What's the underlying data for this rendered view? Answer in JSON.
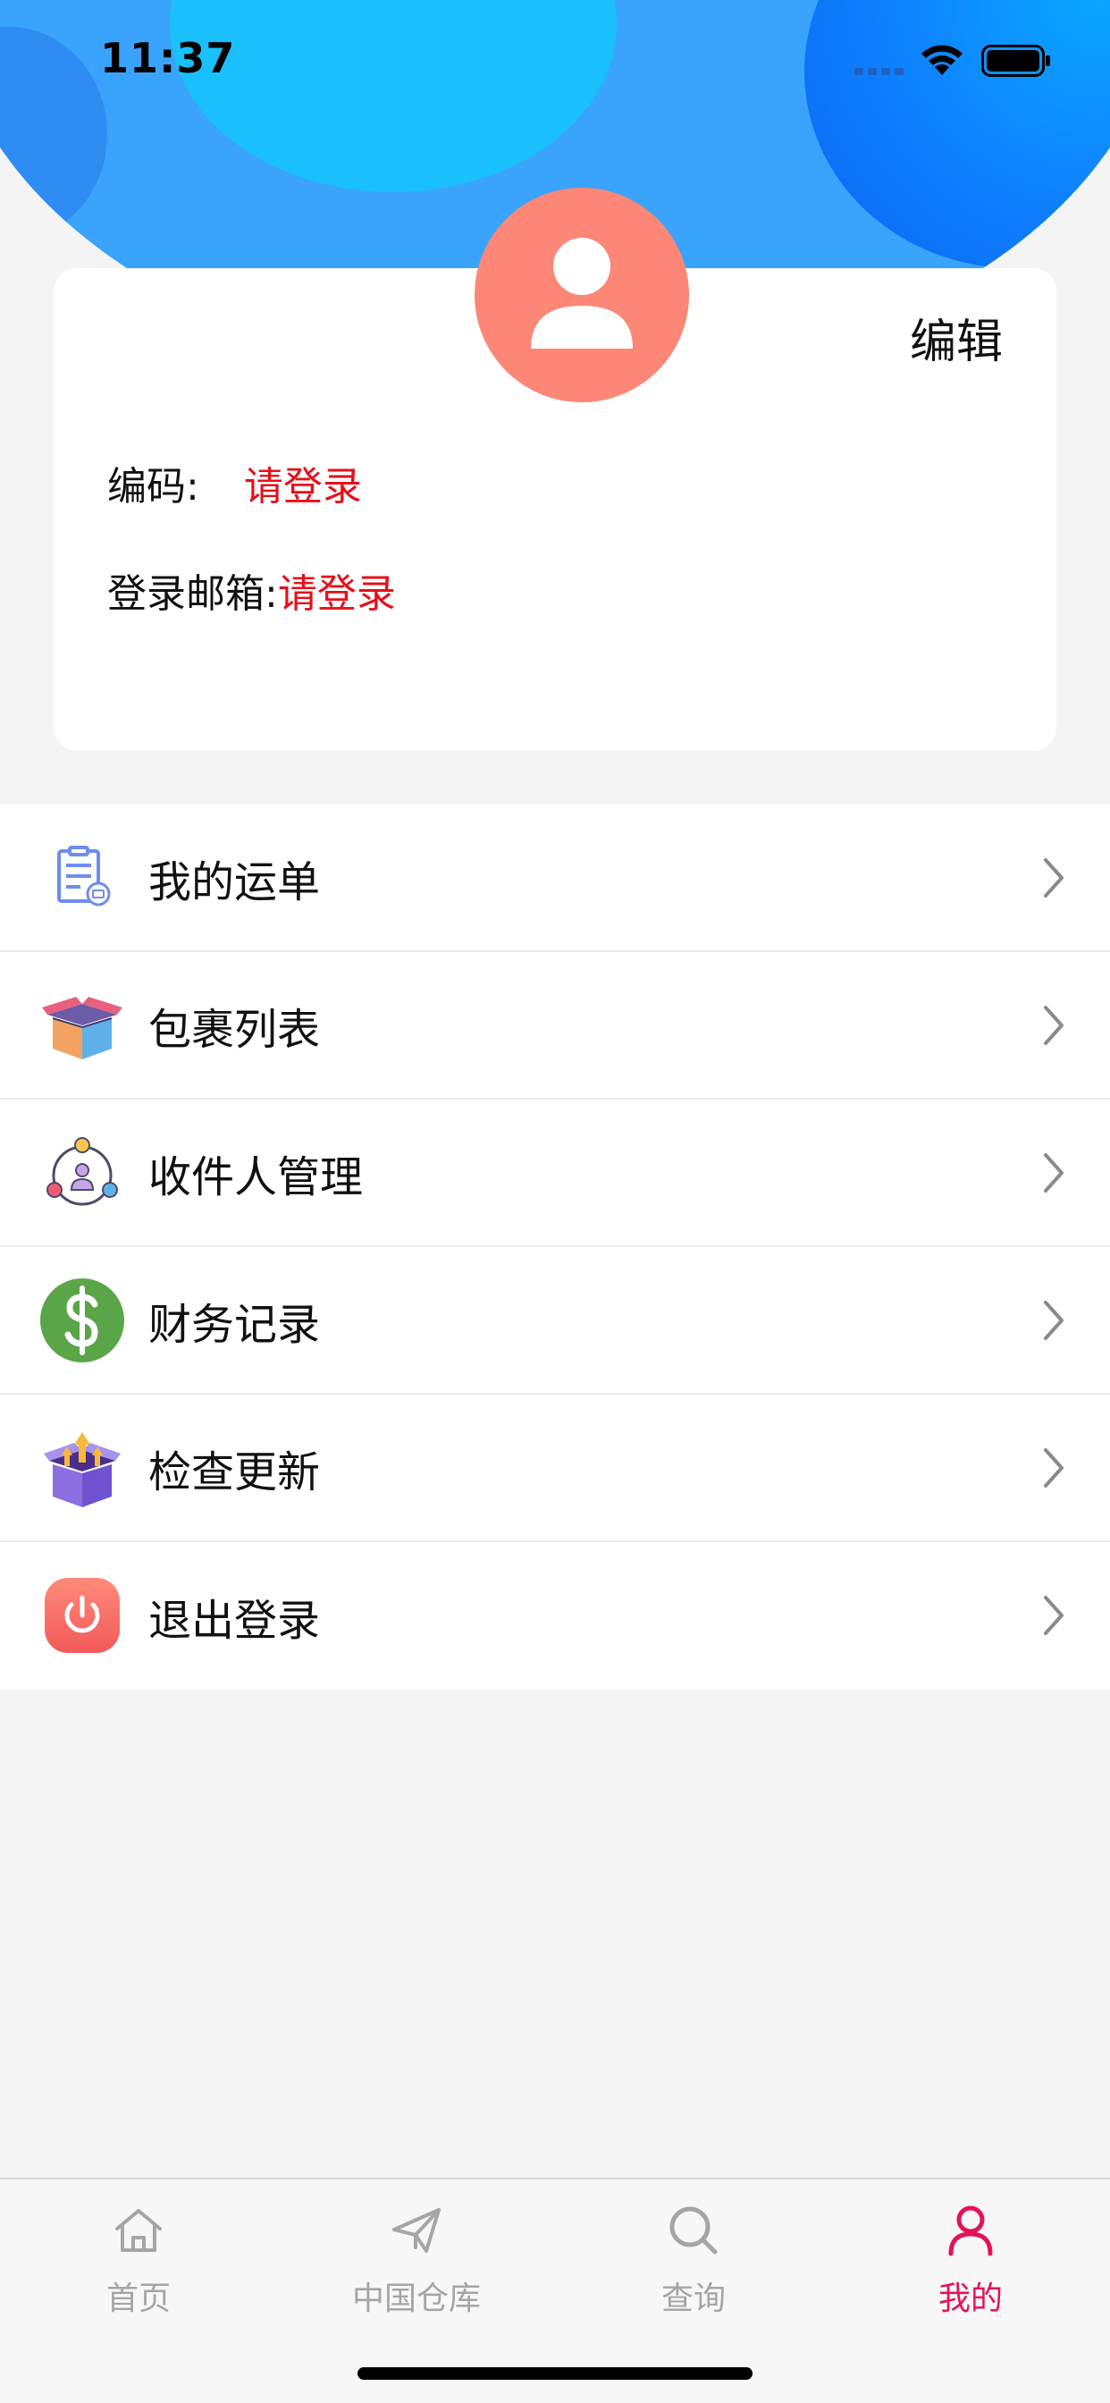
{
  "status_bar": {
    "time": "11:37"
  },
  "profile": {
    "edit_label": "编辑",
    "code_label": "编码:",
    "code_value": "请登录",
    "email_label": "登录邮箱:",
    "email_value": "请登录"
  },
  "menu": {
    "items": [
      {
        "label": "我的运单",
        "icon": "waybill-icon"
      },
      {
        "label": "包裹列表",
        "icon": "package-icon"
      },
      {
        "label": "收件人管理",
        "icon": "recipients-icon"
      },
      {
        "label": "财务记录",
        "icon": "dollar-icon"
      },
      {
        "label": "检查更新",
        "icon": "update-box-icon"
      },
      {
        "label": "退出登录",
        "icon": "power-icon"
      }
    ]
  },
  "tab_bar": {
    "tabs": [
      {
        "label": "首页",
        "icon": "home-icon"
      },
      {
        "label": "中国仓库",
        "icon": "paper-plane-icon"
      },
      {
        "label": "查询",
        "icon": "search-icon"
      },
      {
        "label": "我的",
        "icon": "user-icon"
      }
    ],
    "active_index": 3,
    "active_color": "#e2135a",
    "inactive_color": "#a5a5a5"
  },
  "colors": {
    "header_blue": "#3aa3fb",
    "avatar_bg": "#fc8776",
    "login_prompt_red": "#e5101a"
  }
}
